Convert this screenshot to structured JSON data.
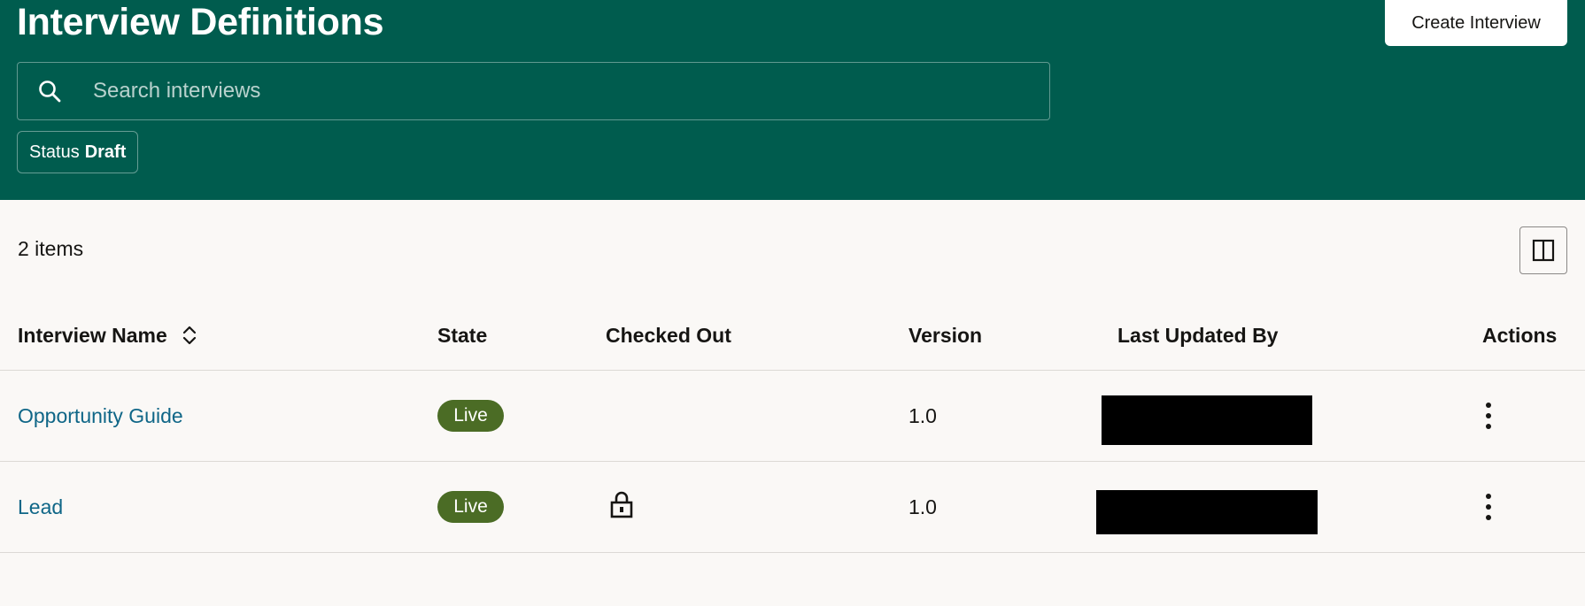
{
  "header": {
    "title": "Interview Definitions",
    "create_label": "Create Interview",
    "search_placeholder": "Search interviews",
    "filter": {
      "label": "Status",
      "value": "Draft"
    }
  },
  "colors": {
    "header_bg": "#005c4e",
    "link": "#0f6687",
    "live_badge": "#4b6c25"
  },
  "list": {
    "count": "2 items",
    "columns": [
      "Interview Name",
      "State",
      "Checked Out",
      "Version",
      "Last Updated By",
      "Actions"
    ],
    "rows": [
      {
        "name": "Opportunity Guide",
        "state": "Live",
        "checked_out": false,
        "version": "1.0"
      },
      {
        "name": "Lead",
        "state": "Live",
        "checked_out": true,
        "version": "1.0"
      }
    ]
  }
}
